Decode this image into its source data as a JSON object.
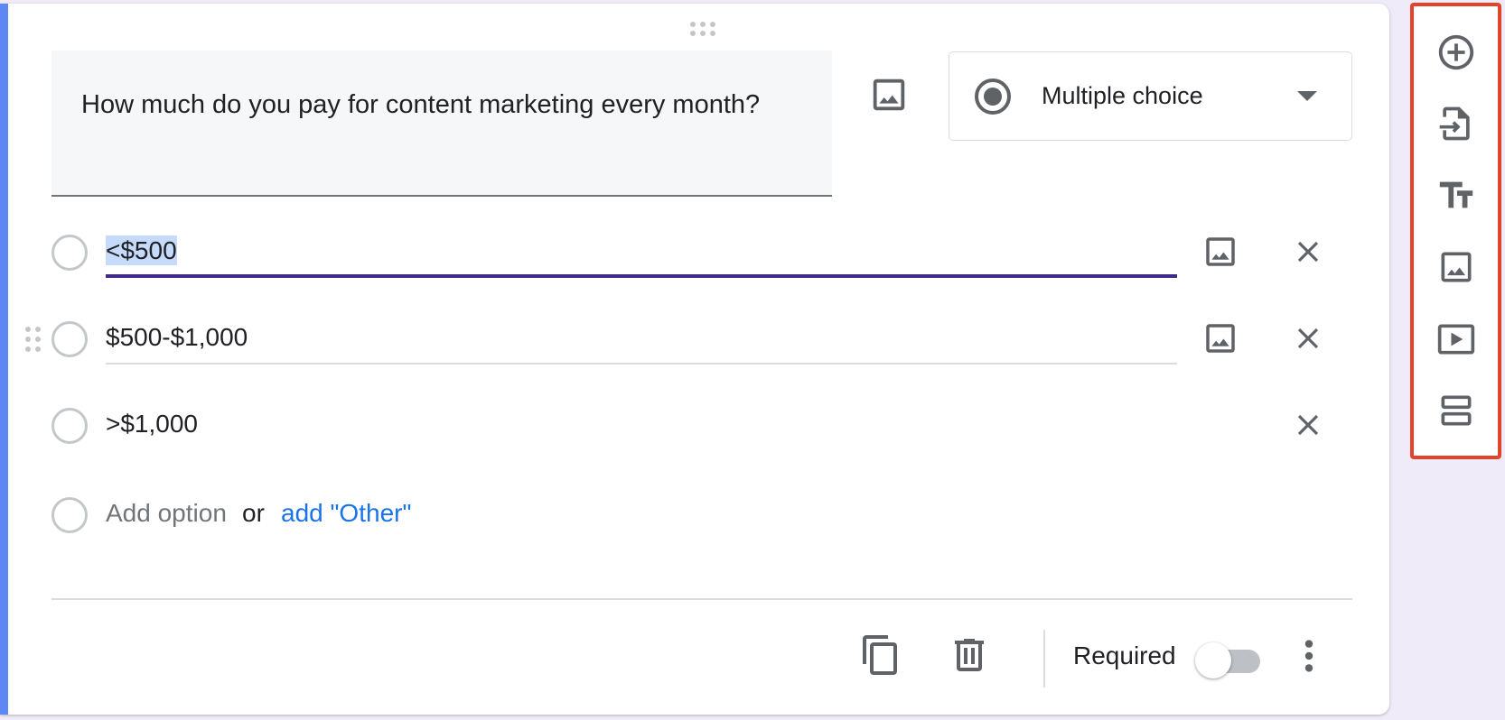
{
  "question": {
    "title": "How much do you pay for content marketing every month?",
    "type_label": "Multiple choice"
  },
  "options": [
    {
      "label": "<$500",
      "active": true
    },
    {
      "label": "$500-$1,000",
      "active": false
    },
    {
      "label": ">$1,000",
      "active": false
    }
  ],
  "add_row": {
    "add_option": "Add option",
    "or": "or",
    "add_other": "add \"Other\""
  },
  "footer": {
    "required_label": "Required",
    "required_on": false
  },
  "toolbar": {
    "items": [
      "add-question-icon",
      "import-questions-icon",
      "add-title-icon",
      "add-image-icon",
      "add-video-icon",
      "add-section-icon"
    ]
  },
  "colors": {
    "card_accent": "#5d87f3",
    "active_underline": "#402a87",
    "link": "#1a73e8",
    "toolbar_highlight": "#e0452b"
  }
}
